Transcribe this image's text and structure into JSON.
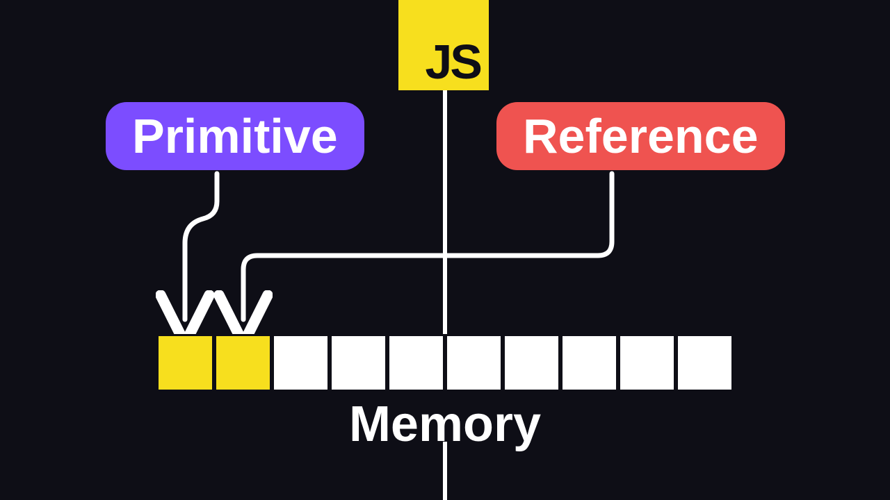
{
  "badge": {
    "label": "JS"
  },
  "pills": {
    "primitive": {
      "label": "Primitive",
      "color": "#7c4dff"
    },
    "reference": {
      "label": "Reference",
      "color": "#ef5350"
    }
  },
  "memory": {
    "label": "Memory",
    "cells": [
      {
        "filled": true
      },
      {
        "filled": true
      },
      {
        "filled": false
      },
      {
        "filled": false
      },
      {
        "filled": false
      },
      {
        "filled": false
      },
      {
        "filled": false
      },
      {
        "filled": false
      },
      {
        "filled": false
      },
      {
        "filled": false
      }
    ]
  },
  "colors": {
    "background": "#0e0e16",
    "accent": "#f7df1e",
    "primitive": "#7c4dff",
    "reference": "#ef5350",
    "line": "#ffffff"
  }
}
